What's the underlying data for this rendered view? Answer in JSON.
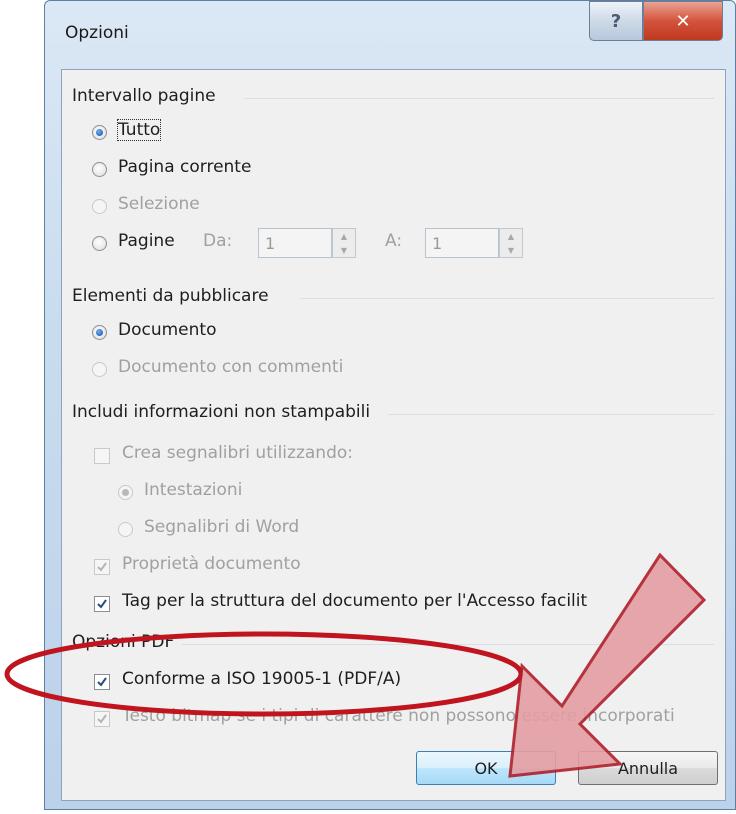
{
  "dialog": {
    "title": "Opzioni",
    "help_icon": "help-question-icon",
    "close_icon": "close-x-icon"
  },
  "page_range": {
    "group_label": "Intervallo pagine",
    "all": "Tutto",
    "current_page": "Pagina corrente",
    "selection": "Selezione",
    "pages": "Pagine",
    "from_label": "Da:",
    "from_value": "1",
    "to_label": "A:",
    "to_value": "1",
    "selected": "Tutto"
  },
  "publish": {
    "group_label": "Elementi da pubblicare",
    "document": "Documento",
    "document_with_comments": "Documento con commenti",
    "selected": "Documento"
  },
  "non_printable": {
    "group_label": "Includi informazioni non stampabili",
    "create_bookmarks": "Crea segnalibri utilizzando:",
    "headings": "Intestazioni",
    "word_bookmarks": "Segnalibri di Word",
    "document_properties": "Proprietà documento",
    "structure_tags": "Tag per la struttura del documento per l'Accesso facilit"
  },
  "pdf_options": {
    "group_label": "Opzioni PDF",
    "iso_compliant": "Conforme a ISO 19005-1 (PDF/A)",
    "bitmap_text": "Testo bitmap se i tipi di carattere non possono essere incorporati"
  },
  "buttons": {
    "ok": "OK",
    "cancel": "Annulla"
  },
  "annotation_colors": {
    "ellipse": "#c0141e",
    "arrow_fill": "#e39ea3",
    "arrow_stroke": "#b01f2a"
  }
}
